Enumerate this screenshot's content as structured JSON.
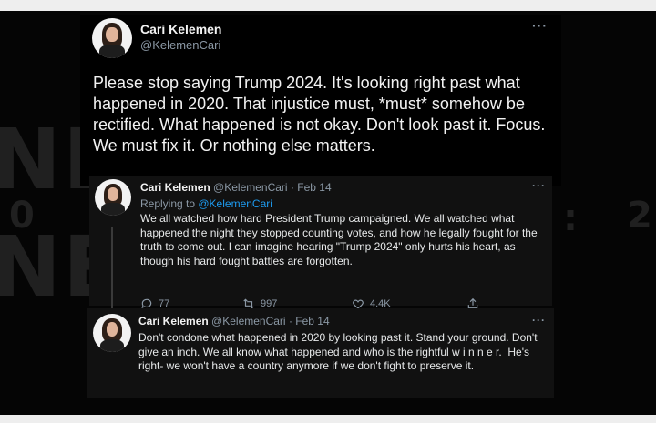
{
  "background": {
    "letters_top": "NEW  YORK",
    "letters_mid": "0",
    "letters_mid_right": ":",
    "letters_right": "2"
  },
  "main_tweet": {
    "name": "Cari Kelemen",
    "handle": "@KelemenCari",
    "more_icon": "more-horizontal-icon",
    "text": "Please stop saying Trump 2024. It's looking right past what happened in 2020. That injustice must, *must* somehow be rectified. What happened is not okay. Don't look past it. Focus. We must fix it. Or nothing else matters."
  },
  "reply_1": {
    "name": "Cari Kelemen",
    "handle": "@KelemenCari",
    "date": "· Feb 14",
    "replying_prefix": "Replying to ",
    "replying_handle": "@KelemenCari",
    "text": "We all watched how hard President Trump campaigned. We all watched what happened the night they stopped counting votes, and how he legally fought for the truth to come out. I can imagine hearing \"Trump 2024\" only hurts his heart, as though his hard fought battles are forgotten.",
    "replies": "77",
    "retweets": "997",
    "likes": "4.4K"
  },
  "reply_2": {
    "name": "Cari Kelemen",
    "handle": "@KelemenCari",
    "date": "· Feb 14",
    "text": "Don't condone what happened in 2020 by looking past it. Stand your ground. Don't give an inch. We all know what happened and who is the rightful w i n n e r.  He's right- we won't have a country anymore if we don't fight to preserve it."
  },
  "colors": {
    "accent": "#1d9bf0",
    "secondary_text": "#8b98a5",
    "primary_text": "#f2f2f2"
  }
}
